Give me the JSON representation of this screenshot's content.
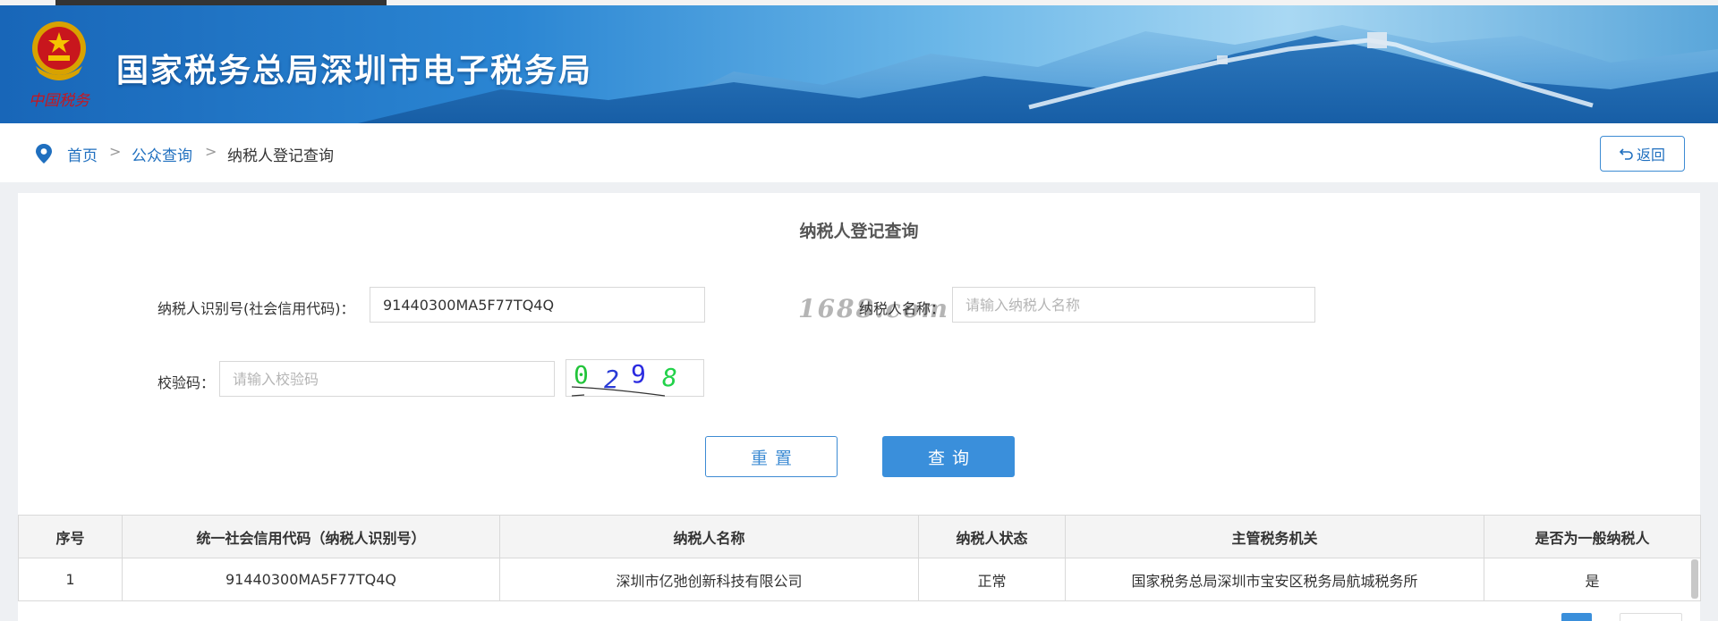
{
  "header": {
    "title": "国家税务总局深圳市电子税务局",
    "emblem_caption": "中国税务"
  },
  "breadcrumb": {
    "items": [
      "首页",
      "公众查询",
      "纳税人登记查询"
    ],
    "separator": ">",
    "back_label": "返回"
  },
  "form": {
    "title": "纳税人登记查询",
    "taxpayer_id_label": "纳税人识别号(社会信用代码)：",
    "taxpayer_id_value": "91440300MA5F77TQ4Q",
    "taxpayer_name_label": "纳税人名称：",
    "taxpayer_name_placeholder": "请输入纳税人名称",
    "captcha_label": "校验码：",
    "captcha_placeholder": "请输入校验码",
    "captcha_digits": [
      "0",
      "2",
      "9",
      "8"
    ],
    "reset_label": "重置",
    "query_label": "查询"
  },
  "watermark": "1688.com",
  "table": {
    "columns": [
      "序号",
      "统一社会信用代码（纳税人识别号）",
      "纳税人名称",
      "纳税人状态",
      "主管税务机关",
      "是否为一般纳税人"
    ],
    "rows": [
      [
        "1",
        "91440300MA5F77TQ4Q",
        "深圳市亿弛创新科技有限公司",
        "正常",
        "国家税务总局深圳市宝安区税务局航城税务所",
        "是"
      ]
    ]
  },
  "colors": {
    "accent": "#3a8fdb",
    "link": "#1f6fbf",
    "banner_dark": "#1866b8"
  }
}
